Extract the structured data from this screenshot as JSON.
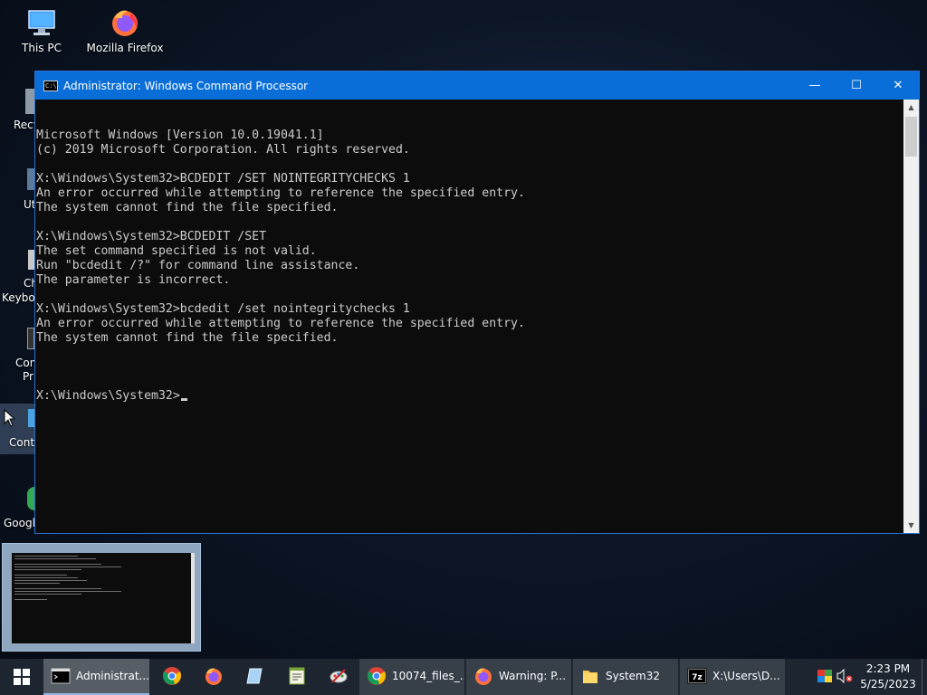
{
  "desktop": {
    "icons": [
      {
        "label": "This PC"
      },
      {
        "label": "Mozilla Firefox"
      }
    ],
    "partial_labels": [
      "Recy",
      "Ut",
      "Ch",
      "Keybo",
      "Con",
      "Pr",
      "Contr",
      "Google"
    ]
  },
  "window": {
    "title": "Administrator: Windows Command Processor",
    "icon_glyph": "C:\\",
    "controls": {
      "minimize": "—",
      "maximize": "☐",
      "close": "✕"
    },
    "lines": [
      "Microsoft Windows [Version 10.0.19041.1]",
      "(c) 2019 Microsoft Corporation. All rights reserved.",
      "",
      "X:\\Windows\\System32>BCDEDIT /SET NOINTEGRITYCHECKS 1",
      "An error occurred while attempting to reference the specified entry.",
      "The system cannot find the file specified.",
      "",
      "X:\\Windows\\System32>BCDEDIT /SET",
      "The set command specified is not valid.",
      "Run \"bcdedit /?\" for command line assistance.",
      "The parameter is incorrect.",
      "",
      "X:\\Windows\\System32>bcdedit /set nointegritychecks 1",
      "An error occurred while attempting to reference the specified entry.",
      "The system cannot find the file specified.",
      ""
    ],
    "prompt": "X:\\Windows\\System32>",
    "scroll_up": "▲",
    "scroll_down": "▼"
  },
  "taskbar": {
    "items": [
      {
        "label": "Administrat...",
        "active": true
      },
      {
        "label": "10074_files_..."
      },
      {
        "label": "Warning: P..."
      },
      {
        "label": "System32"
      },
      {
        "label": "X:\\Users\\D..."
      }
    ],
    "clock": {
      "time": "2:23 PM",
      "date": "5/25/2023"
    }
  },
  "colors": {
    "titlebar": "#0a6ed8",
    "console_bg": "#0c0c0c",
    "console_fg": "#cccccc",
    "taskbar": "#1c2530"
  }
}
